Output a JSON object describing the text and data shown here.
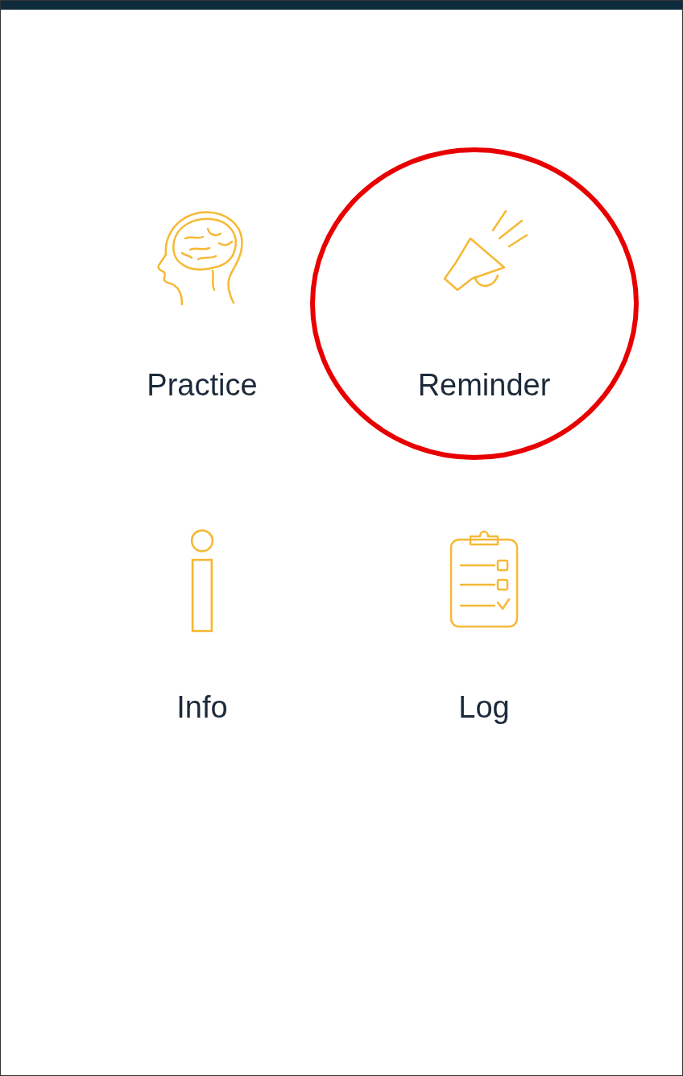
{
  "menu": [
    {
      "label": "Practice",
      "kind": "brain",
      "circled": false
    },
    {
      "label": "Reminder",
      "kind": "megaphone",
      "circled": true
    },
    {
      "label": "Info",
      "kind": "info",
      "circled": false
    },
    {
      "label": "Log",
      "kind": "clipboard",
      "circled": false
    }
  ]
}
